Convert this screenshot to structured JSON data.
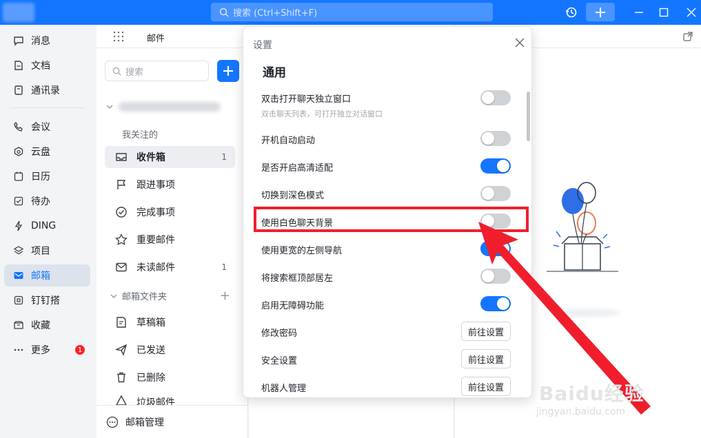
{
  "topbar": {
    "search_placeholder": "搜索 (Ctrl+Shift+F)",
    "icons": [
      "history-icon",
      "plus-icon",
      "minimize-icon",
      "maximize-icon",
      "close-icon"
    ]
  },
  "leftnav": {
    "items": [
      {
        "label": "消息",
        "icon": "message-icon"
      },
      {
        "label": "文档",
        "icon": "document-icon"
      },
      {
        "label": "通讯录",
        "icon": "contacts-icon"
      },
      {
        "label": "会议",
        "icon": "phone-icon"
      },
      {
        "label": "云盘",
        "icon": "cloud-icon"
      },
      {
        "label": "日历",
        "icon": "calendar-icon"
      },
      {
        "label": "待办",
        "icon": "todo-icon"
      },
      {
        "label": "DING",
        "icon": "lightning-icon"
      },
      {
        "label": "项目",
        "icon": "project-icon"
      },
      {
        "label": "邮箱",
        "icon": "mail-icon"
      },
      {
        "label": "钉钉搭",
        "icon": "builder-icon"
      },
      {
        "label": "收藏",
        "icon": "favorites-icon"
      },
      {
        "label": "更多",
        "icon": "more-icon"
      }
    ],
    "more_badge": "1"
  },
  "mail": {
    "title": "邮件",
    "search_placeholder": "搜索",
    "followed_label": "我关注的",
    "folders": [
      {
        "label": "收件箱",
        "count": "1"
      },
      {
        "label": "跟进事项",
        "count": ""
      },
      {
        "label": "完成事项",
        "count": ""
      },
      {
        "label": "重要邮件",
        "count": ""
      },
      {
        "label": "未读邮件",
        "count": "1"
      }
    ],
    "folders_header": "邮箱文件夹",
    "mail_folders": [
      {
        "label": "草稿箱"
      },
      {
        "label": "已发送"
      },
      {
        "label": "已删除"
      },
      {
        "label": "垃圾邮件"
      }
    ],
    "footer_label": "邮箱管理"
  },
  "settings": {
    "title": "设置",
    "section": "通用",
    "rows": [
      {
        "label": "双击打开聊天独立窗口",
        "sub": "双击聊天列表，可打开独立对话窗口",
        "on": false
      },
      {
        "label": "开机自动启动",
        "on": false
      },
      {
        "label": "是否开启高清适配",
        "on": true
      },
      {
        "label": "切换到深色模式",
        "on": false
      },
      {
        "label": "使用白色聊天背景",
        "on": false
      },
      {
        "label": "使用更宽的左侧导航",
        "on": true
      },
      {
        "label": "将搜索框顶部居左",
        "on": false
      },
      {
        "label": "启用无障碍功能",
        "on": true
      }
    ],
    "link_rows": [
      {
        "label": "修改密码",
        "button": "前往设置"
      },
      {
        "label": "安全设置",
        "button": "前往设置"
      },
      {
        "label": "机器人管理",
        "button": "前往设置"
      }
    ]
  },
  "watermark": {
    "main": "Baidu经验",
    "sub": "jingyan.baidu.com"
  },
  "colors": {
    "brand": "#1476ff",
    "highlight": "#f01e2c",
    "toggle_off": "#d0d3d6"
  }
}
